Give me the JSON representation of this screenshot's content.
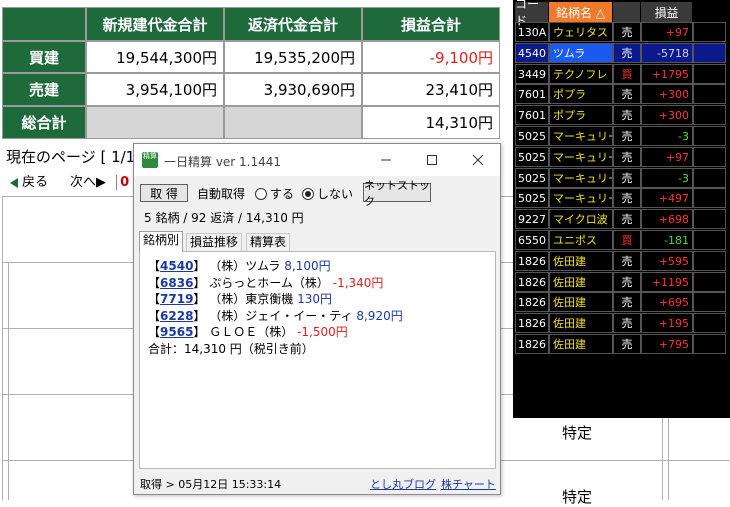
{
  "summary": {
    "headers": [
      "新規建代金合計",
      "返済代金合計",
      "損益合計"
    ],
    "rows": [
      {
        "label": "買建",
        "new": "19,544,300円",
        "close": "19,535,200円",
        "pl": "-9,100円"
      },
      {
        "label": "売建",
        "new": "3,954,100円",
        "close": "3,930,690円",
        "pl": "23,410円"
      },
      {
        "label": "総合計",
        "pl": "14,310円"
      }
    ]
  },
  "nav": {
    "page_indicator": "現在のページ [ 1/1",
    "back": "戻る",
    "next": "次へ▶",
    "partial": "0"
  },
  "background": {
    "tokutei_1": "特定",
    "tokutei_2": "特定"
  },
  "ticker": {
    "headers": [
      "コード",
      "銘柄名 △",
      "",
      "損益"
    ],
    "rows": [
      {
        "code": "130A",
        "name": "ウェリタス",
        "side": "売",
        "pl": "+97"
      },
      {
        "code": "4540",
        "name": "ツムラ",
        "side": "売",
        "pl": "-5718"
      },
      {
        "code": "3449",
        "name": "テクノフレ",
        "side": "買",
        "pl": "+1795"
      },
      {
        "code": "7601",
        "name": "ポプラ",
        "side": "売",
        "pl": "+300"
      },
      {
        "code": "7601",
        "name": "ポプラ",
        "side": "売",
        "pl": "+300"
      },
      {
        "code": "5025",
        "name": "マーキュリー",
        "side": "売",
        "pl": "-3"
      },
      {
        "code": "5025",
        "name": "マーキュリー",
        "side": "売",
        "pl": "+97"
      },
      {
        "code": "5025",
        "name": "マーキュリー",
        "side": "売",
        "pl": "-3"
      },
      {
        "code": "5025",
        "name": "マーキュリー",
        "side": "売",
        "pl": "+497"
      },
      {
        "code": "9227",
        "name": "マイクロ波",
        "side": "売",
        "pl": "+698"
      },
      {
        "code": "6550",
        "name": "ユニポス",
        "side": "買",
        "pl": "-181"
      },
      {
        "code": "1826",
        "name": "佐田建",
        "side": "売",
        "pl": "+595"
      },
      {
        "code": "1826",
        "name": "佐田建",
        "side": "売",
        "pl": "+1195"
      },
      {
        "code": "1826",
        "name": "佐田建",
        "side": "売",
        "pl": "+695"
      },
      {
        "code": "1826",
        "name": "佐田建",
        "side": "売",
        "pl": "+195"
      },
      {
        "code": "1826",
        "name": "佐田建",
        "side": "売",
        "pl": "+795"
      }
    ]
  },
  "popup": {
    "title": "一日精算 ver 1.1441",
    "icon_text": "精算",
    "fetch_button": "取 得",
    "auto_fetch_label": "自動取得",
    "radio_on": "する",
    "radio_off": "しない",
    "netstock_button": "ネットストック",
    "status": "5 銘柄 / 92 返済 / 14,310 円",
    "tabs": [
      "銘柄別",
      "損益推移",
      "精算表"
    ],
    "items": [
      {
        "code": "4540",
        "name": "（株）ツムラ",
        "amount": "8,100円",
        "sign": "pos"
      },
      {
        "code": "6836",
        "name": "ぷらっとホーム（株）",
        "amount": "-1,340円",
        "sign": "neg"
      },
      {
        "code": "7719",
        "name": "（株）東京衡機",
        "amount": "130円",
        "sign": "pos"
      },
      {
        "code": "6228",
        "name": "（株）ジェイ・イー・ティ",
        "amount": "8,920円",
        "sign": "pos"
      },
      {
        "code": "9565",
        "name": "ＧＬＯＥ（株）",
        "amount": "-1,500円",
        "sign": "neg"
      }
    ],
    "total": "合計：14,310 円（税引き前）",
    "footer_left": "取得 > 05月12日 15:33:14",
    "blog_link": "とし丸ブログ",
    "chart_link": "株チャート"
  },
  "colors": {
    "header_green": "#1e6a3a",
    "negative_red": "#e02020",
    "link_blue": "#1a3aa0",
    "ticker_bg": "#000000",
    "ticker_name_yellow": "#f2e020"
  },
  "icons": [
    "app-icon",
    "minimize-icon",
    "maximize-icon",
    "close-icon",
    "back-arrow-icon"
  ]
}
